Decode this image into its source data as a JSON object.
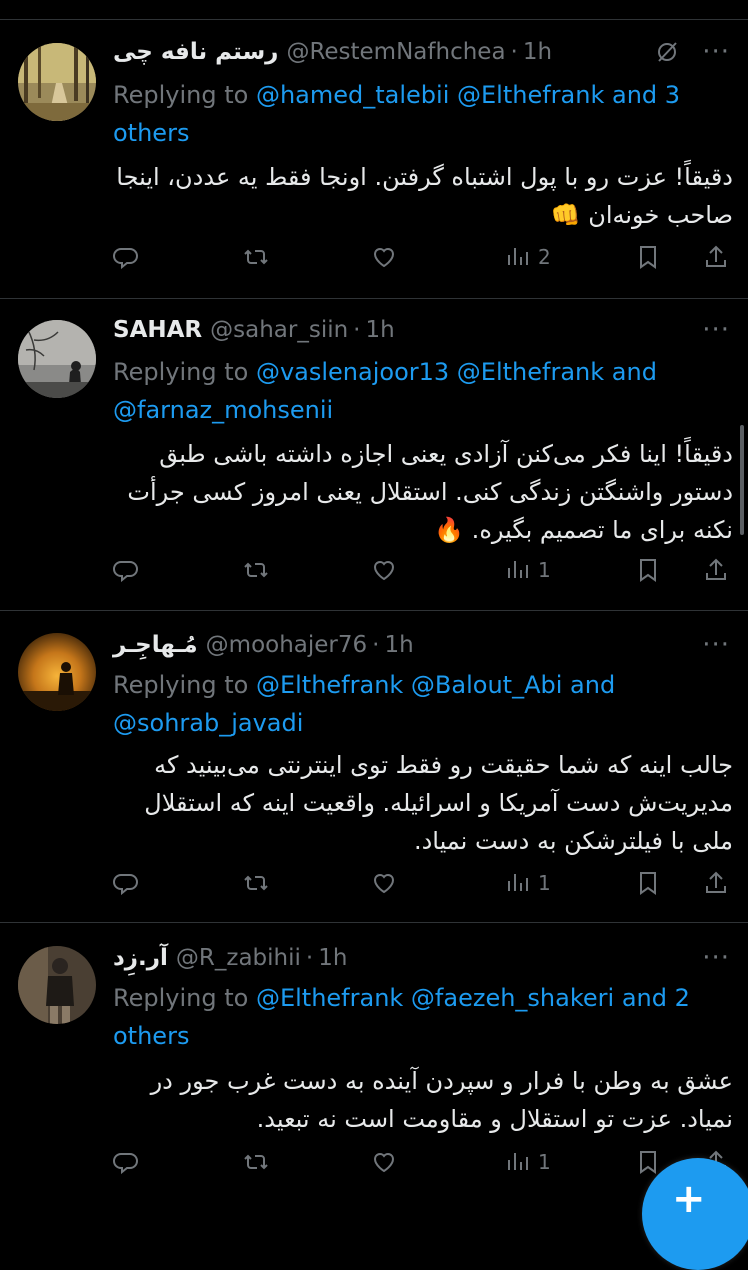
{
  "colors": {
    "background": "#000000",
    "text": "#e7e9ea",
    "muted": "#71767b",
    "link": "#1d9bf0",
    "divider": "#2f3336"
  },
  "tweets": [
    {
      "name": "رستم نافه چی",
      "handle": "@RestemNafhchea",
      "time": "1h",
      "reply_prefix": "Replying to",
      "mentions": "@hamed_talebii @Elthefrank",
      "reply_suffix": "and 3 others",
      "text": "دقیقاً! عزت رو با پول اشتباه گرفتن. اونجا فقط یه عددن، اینجا صاحب خونه‌ان 👊",
      "views": "2",
      "icons": [
        "reply-icon",
        "retweet-icon",
        "like-icon",
        "views-icon",
        "bookmark-icon",
        "share-icon"
      ]
    },
    {
      "name": "SAHAR",
      "handle": "@sahar_siin",
      "time": "1h",
      "reply_prefix": "Replying to",
      "mentions": "@vaslenajoor13 @Elthefrank",
      "reply_suffix": "and",
      "mentions2": "@farnaz_mohsenii",
      "text": "دقیقاً! اینا فکر می‌کنن آزادی یعنی اجازه داشته باشی طبق دستور واشنگتن زندگی کنی. استقلال یعنی امروز کسی جرأت نکنه برای ما تصمیم بگیره. 🔥",
      "views": "1"
    },
    {
      "name": "مُـهاجِـر",
      "handle": "@moohajer76",
      "time": "1h",
      "reply_prefix": "Replying to",
      "mentions": "@Elthefrank @Balout_Abi",
      "reply_suffix": "and",
      "mentions2": "@sohrab_javadi",
      "text": "جالب اینه که شما حقیقت رو فقط توی اینترنتی می‌بینید که مدیریت‌ش دست آمریکا و اسرائیله. واقعیت اینه که استقلال ملی با فیلترشکن به دست نمیاد.",
      "views": "1"
    },
    {
      "name": "آر.زِد",
      "handle": "@R_zabihii",
      "time": "1h",
      "reply_prefix": "Replying to",
      "mentions": "@Elthefrank @faezeh_shakeri",
      "reply_suffix": "and 2 others",
      "text": "عشق به وطن با فرار و سپردن آینده به دست غرب جور در نمیاد. عزت تو استقلال و مقاومت است نه تبعید.",
      "views": "1"
    }
  ],
  "dot": "·",
  "more": "···",
  "fab_label": "+"
}
